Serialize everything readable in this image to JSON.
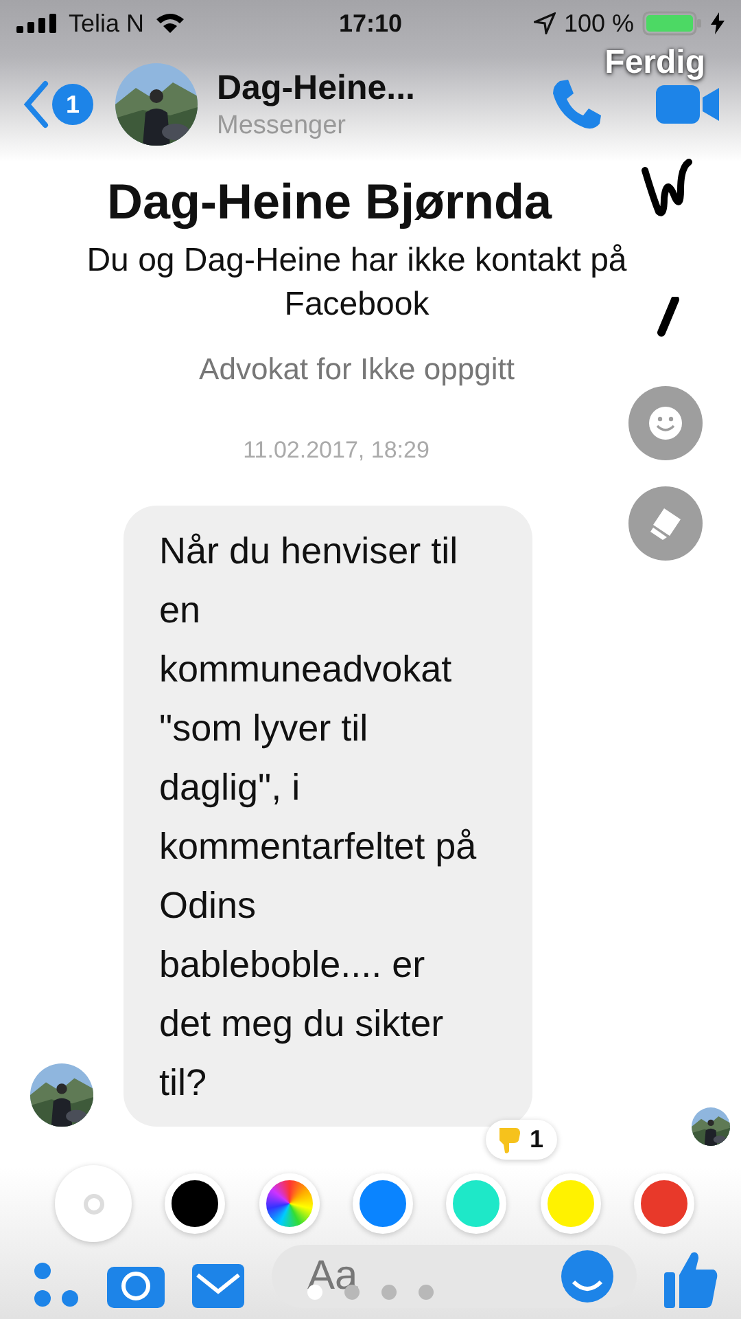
{
  "status_bar": {
    "carrier": "Telia N",
    "time": "17:10",
    "battery": "100 %",
    "charging": true
  },
  "header": {
    "back_badge": "1",
    "name": "Dag-Heine...",
    "subtitle": "Messenger",
    "done": "Ferdig"
  },
  "profile": {
    "name": "Dag-Heine Bjørnda",
    "note": "Du og Dag-Heine har ikke kontakt på Facebook",
    "work": "Advokat for Ikke oppgitt"
  },
  "timestamp": "11.02.2017, 18:29",
  "message": {
    "text": "Når du henviser til en kommuneadvokat \"som lyver til daglig\", i kommentarfeltet på Odins bableboble.... er det meg du sikter til?",
    "reaction_count": "1"
  },
  "composer": {
    "placeholder": "Aa"
  },
  "palette": [
    {
      "kind": "swatch",
      "color": "#ffffff",
      "selected": true
    },
    {
      "kind": "swatch",
      "color": "#000000",
      "selected": false
    },
    {
      "kind": "spectrum",
      "selected": false
    },
    {
      "kind": "swatch",
      "color": "#0a84ff",
      "selected": false
    },
    {
      "kind": "swatch",
      "color": "#1ee8c8",
      "selected": false
    },
    {
      "kind": "swatch",
      "color": "#fff200",
      "selected": false
    },
    {
      "kind": "swatch",
      "color": "#e8392a",
      "selected": false
    }
  ],
  "pages": [
    {
      "selected": true
    },
    {
      "selected": false
    },
    {
      "selected": false
    },
    {
      "selected": false
    }
  ]
}
